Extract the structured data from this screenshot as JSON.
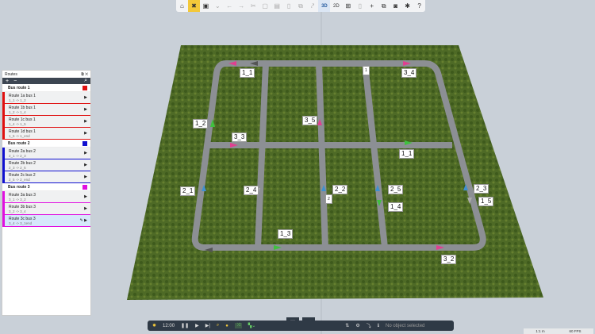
{
  "toolbar": {
    "items": [
      "home-icon",
      "tools-icon",
      "save-icon",
      "undo-icon",
      "redo-icon",
      "cut-icon",
      "copy-icon",
      "paste-icon",
      "delete-icon",
      "duplicate-icon",
      "link-icon",
      "3D",
      "2D",
      "grid-icon",
      "marker-icon",
      "add-icon",
      "layers-icon",
      "camera-icon",
      "plugin-icon",
      "?"
    ]
  },
  "panel": {
    "title": "Routes",
    "groups": [
      {
        "name": "Bus route 1",
        "color": "#e01010",
        "routes": [
          {
            "name": "Route 1a bus 1",
            "path": "1_1 -> 1_2"
          },
          {
            "name": "Route 1b bus 1",
            "path": "1_2 -> 1_4"
          },
          {
            "name": "Route 1c bus 1",
            "path": "1_4 -> 1_5"
          },
          {
            "name": "Route 1d bus 1",
            "path": "1_5 -> 1_end"
          }
        ]
      },
      {
        "name": "Bus route 2",
        "color": "#1010d0",
        "routes": [
          {
            "name": "Route 2a bus 2",
            "path": "2_1 -> 2_3"
          },
          {
            "name": "Route 2b bus 2",
            "path": "2_3 -> 2_5"
          },
          {
            "name": "Route 2c bus 2",
            "path": "2_5 -> 2_end"
          }
        ]
      },
      {
        "name": "Bus route 3",
        "color": "#e010e0",
        "routes": [
          {
            "name": "Route 3a bus 3",
            "path": "3_1 -> 3_2"
          },
          {
            "name": "Route 3b bus 3",
            "path": "3_2 -> 3_4"
          },
          {
            "name": "Route 3c bus 3",
            "path": "3_4 -> 3_1end"
          }
        ]
      }
    ]
  },
  "bottom": {
    "time": "12:00",
    "status": "No object selected"
  },
  "statusbar": {
    "scale": "1:1 m",
    "fps": "60 FPS"
  },
  "labels": [
    "1_1",
    "3_4",
    "1",
    "1_2",
    "3_5",
    "3_3",
    "1_1",
    "2_1",
    "2_4",
    "2_2",
    "2",
    "2_5",
    "1_4",
    "2_3",
    "1_5",
    "1_3",
    "3_2"
  ]
}
